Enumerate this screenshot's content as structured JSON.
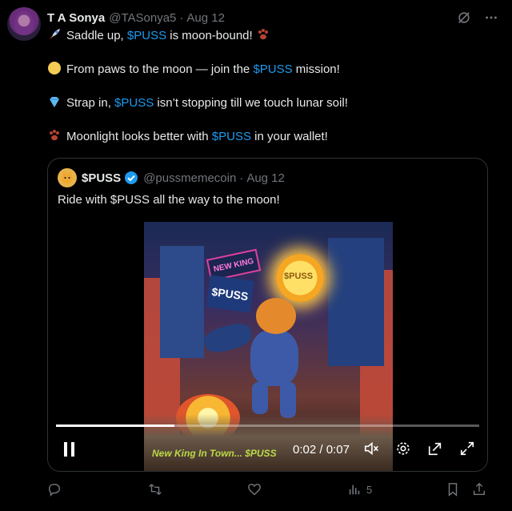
{
  "author": {
    "name": "T A Sonya",
    "handle": "@TASonya5",
    "date": "Aug 12"
  },
  "tweet": {
    "lines": [
      {
        "emoji": "rocket-icon",
        "parts": [
          "Saddle up, ",
          "$PUSS",
          " is moon-bound! "
        ],
        "trail_emoji": "paw-icon"
      },
      {
        "emoji": "full-moon-icon",
        "parts": [
          "From paws to the moon — join the ",
          "$PUSS",
          " mission!"
        ]
      },
      {
        "emoji": "diamond-icon",
        "parts": [
          "Strap in, ",
          "$PUSS",
          " isn’t stopping till we touch lunar soil!"
        ]
      },
      {
        "emoji": "paw-icon",
        "parts": [
          "Moonlight looks better with ",
          "$PUSS",
          " in your wallet!"
        ]
      }
    ]
  },
  "quote": {
    "name": "$PUSS",
    "handle": "@pussmemecoin",
    "date": "Aug 12",
    "text": "Ride with $PUSS all the way to the moon!",
    "video": {
      "sign_text_1": "NEW KING",
      "sign_text_2": "$PUSS",
      "coin_text": "$PUSS",
      "caption": "New King In Town... $PUSS",
      "current_time": "0:02",
      "separator": "/",
      "duration": "0:07",
      "progress": 0.28
    }
  },
  "actions": {
    "views": "5"
  },
  "colors": {
    "accent": "#1d9bf0",
    "muted": "#71767b",
    "text": "#e7e9ea",
    "background": "#000000"
  }
}
